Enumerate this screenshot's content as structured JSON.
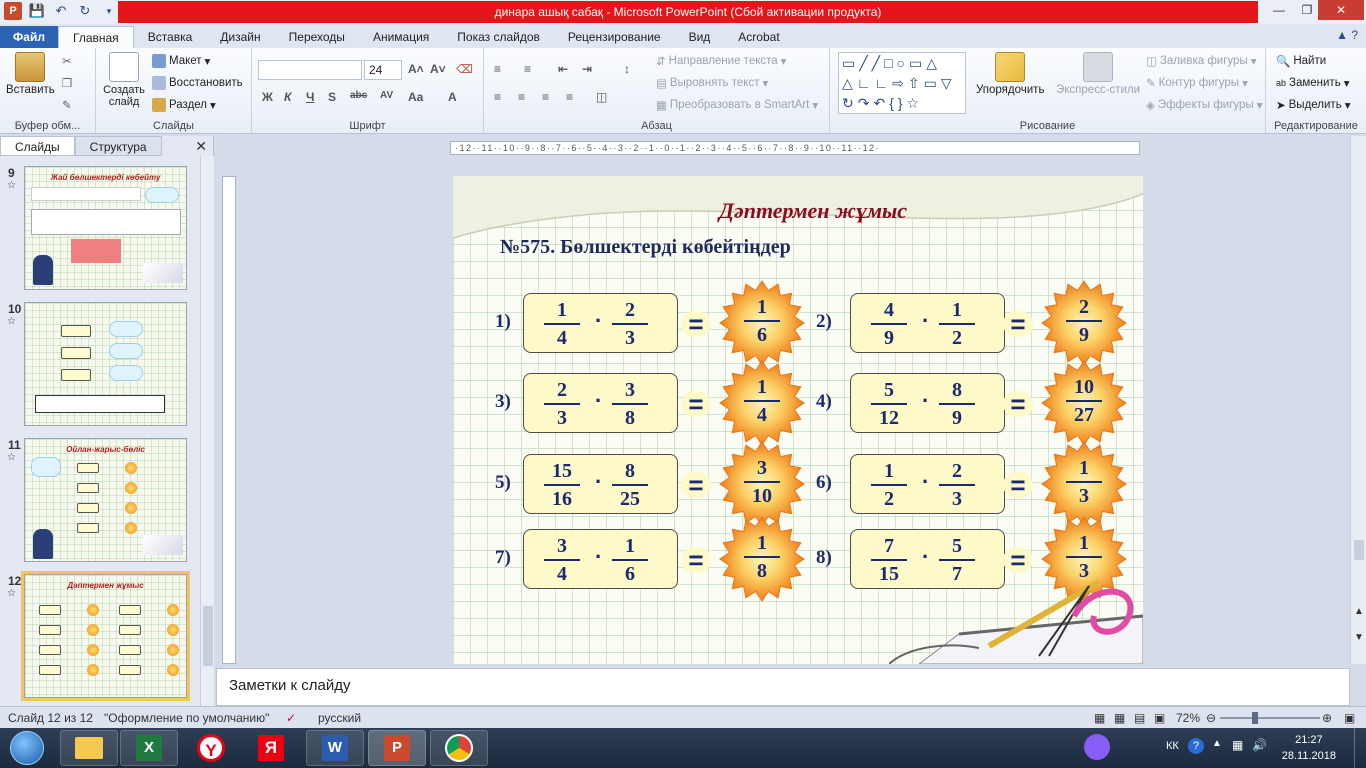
{
  "window": {
    "title": "динара ашық сабақ  -  Microsoft PowerPoint (Сбой активации продукта)"
  },
  "tabs": [
    "Файл",
    "Главная",
    "Вставка",
    "Дизайн",
    "Переходы",
    "Анимация",
    "Показ слайдов",
    "Рецензирование",
    "Вид",
    "Acrobat"
  ],
  "ribbon": {
    "clipboard": {
      "label": "Буфер обм...",
      "paste": "Вставить"
    },
    "slides": {
      "label": "Слайды",
      "new_slide": "Создать слайд",
      "layout": "Макет",
      "reset": "Восстановить",
      "section": "Раздел"
    },
    "font": {
      "label": "Шрифт",
      "size": "24"
    },
    "paragraph": {
      "label": "Абзац",
      "text_direction": "Направление текста",
      "align_text": "Выровнять текст",
      "smartart": "Преобразовать в SmartArt"
    },
    "drawing": {
      "label": "Рисование",
      "arrange": "Упорядочить",
      "quick_styles": "Экспресс-стили",
      "shape_fill": "Заливка фигуры",
      "shape_outline": "Контур фигуры",
      "shape_effects": "Эффекты фигуры"
    },
    "editing": {
      "label": "Редактирование",
      "find": "Найти",
      "replace": "Заменить",
      "select": "Выделить"
    }
  },
  "left_panel": {
    "tabs": [
      "Слайды",
      "Структура"
    ],
    "thumbnails": [
      {
        "num": "9",
        "title": "Жай бөлшектерді көбейту"
      },
      {
        "num": "10",
        "title": ""
      },
      {
        "num": "11",
        "title": "Ойлан-жарыс-бөліс"
      },
      {
        "num": "12",
        "title": "Дәптермен жұмыс"
      }
    ]
  },
  "slide": {
    "title": "Дәптермен жұмыс",
    "subtitle": "№575. Бөлшектерді көбейтіңдер",
    "exercises": [
      {
        "label": "1)",
        "a": [
          "1",
          "4"
        ],
        "b": [
          "2",
          "3"
        ],
        "r": [
          "1",
          "6"
        ]
      },
      {
        "label": "2)",
        "a": [
          "4",
          "9"
        ],
        "b": [
          "1",
          "2"
        ],
        "r": [
          "2",
          "9"
        ]
      },
      {
        "label": "3)",
        "a": [
          "2",
          "3"
        ],
        "b": [
          "3",
          "8"
        ],
        "r": [
          "1",
          "4"
        ]
      },
      {
        "label": "4)",
        "a": [
          "5",
          "12"
        ],
        "b": [
          "8",
          "9"
        ],
        "r": [
          "10",
          "27"
        ]
      },
      {
        "label": "5)",
        "a": [
          "15",
          "16"
        ],
        "b": [
          "8",
          "25"
        ],
        "r": [
          "3",
          "10"
        ]
      },
      {
        "label": "6)",
        "a": [
          "1",
          "2"
        ],
        "b": [
          "2",
          "3"
        ],
        "r": [
          "1",
          "3"
        ]
      },
      {
        "label": "7)",
        "a": [
          "3",
          "4"
        ],
        "b": [
          "1",
          "6"
        ],
        "r": [
          "1",
          "8"
        ]
      },
      {
        "label": "8)",
        "a": [
          "7",
          "15"
        ],
        "b": [
          "5",
          "7"
        ],
        "r": [
          "1",
          "3"
        ]
      }
    ],
    "dot": "·",
    "eq": "="
  },
  "notes": {
    "placeholder": "Заметки к слайду"
  },
  "status": {
    "slide_count": "Слайд 12 из 12",
    "theme": "\"Оформление по умолчанию\"",
    "language": "русский",
    "zoom": "72%"
  },
  "taskbar": {
    "lang": "КК",
    "time": "21:27",
    "date": "28.11.2018"
  },
  "colors": {
    "accent_red": "#e4161b",
    "file_tab": "#2d63b4",
    "slide_title": "#8b0d1d",
    "fraction_blue": "#1b2a70"
  }
}
